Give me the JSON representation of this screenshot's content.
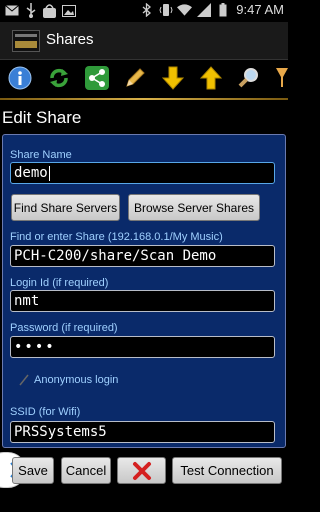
{
  "status_bar": {
    "left_icons": [
      "envelope-icon",
      "usb-icon",
      "bag-icon",
      "image-icon"
    ],
    "right_icons": [
      "bluetooth-icon",
      "vibrate-icon",
      "wifi-icon",
      "signal-icon",
      "battery-icon"
    ],
    "time": "9:47 AM"
  },
  "action_bar": {
    "title": "Shares"
  },
  "toolbar": {
    "buttons": [
      "info-icon",
      "refresh-icon",
      "share-icon",
      "pencil-icon",
      "down-arrow-icon",
      "up-arrow-icon",
      "search-icon",
      "filter-icon"
    ]
  },
  "page": {
    "title": "Edit Share"
  },
  "form": {
    "share_name_label": "Share Name",
    "share_name_value": "demo",
    "find_servers_label": "Find Share Servers",
    "browse_shares_label": "Browse Server Shares",
    "share_path_label": "Find or enter Share (192.168.0.1/My Music)",
    "share_path_value": "PCH-C200/share/Scan Demo",
    "login_label": "Login Id (if required)",
    "login_value": "nmt",
    "password_label": "Password (if required)",
    "password_value": "••••",
    "anonymous_label": "Anonymous login",
    "anonymous_checked": false,
    "ssid_label": "SSID (for Wifi)",
    "ssid_value": "PRSSystems5"
  },
  "bottom_bar": {
    "save_label": "Save",
    "cancel_label": "Cancel",
    "delete_icon": "red-x-icon",
    "test_label": "Test Connection"
  },
  "colors": {
    "panel_bg": "#0a2a6a",
    "label_text": "#9fd0ff",
    "accent_gold": "#d9b24a",
    "field_focus": "#58a7e8"
  }
}
